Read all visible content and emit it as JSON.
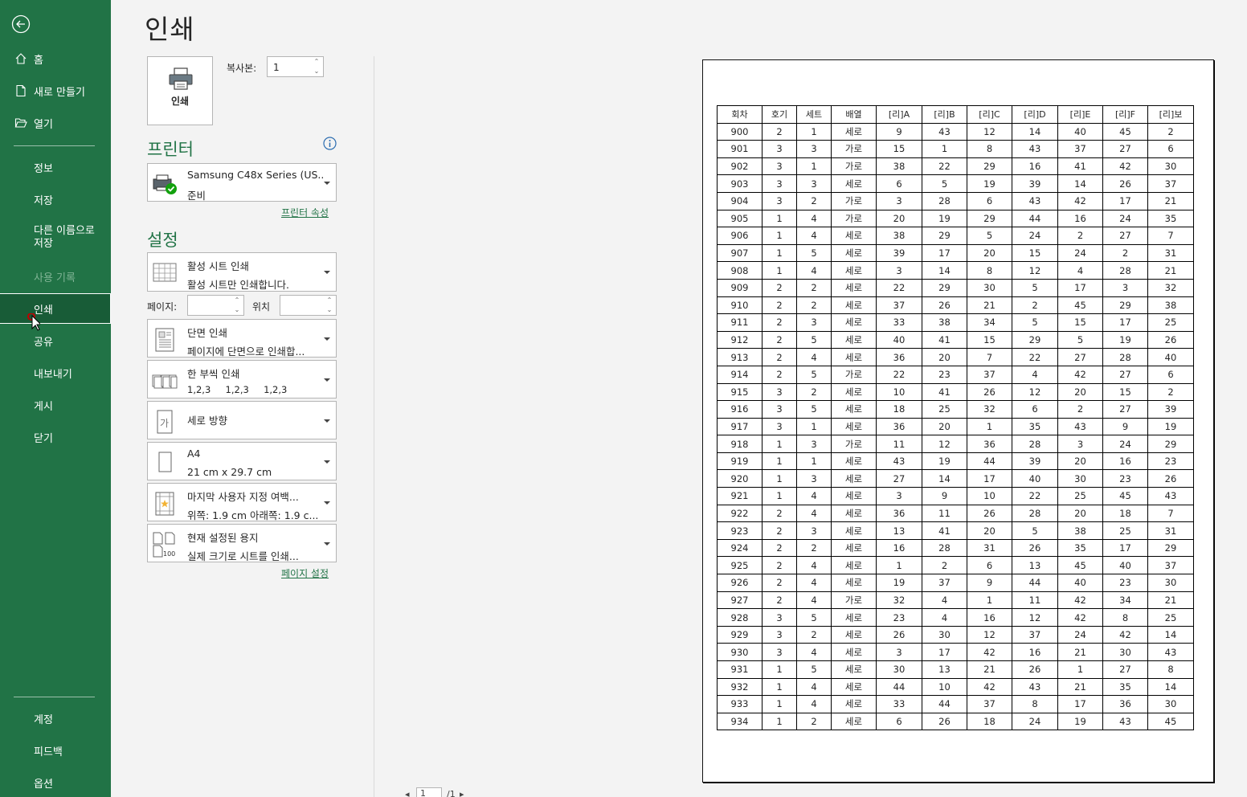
{
  "sidebar": {
    "home": "홈",
    "new": "새로 만들기",
    "open": "열기",
    "info": "정보",
    "save": "저장",
    "save_as": "다른 이름으로 저장",
    "history": "사용 기록",
    "print": "인쇄",
    "share": "공유",
    "export": "내보내기",
    "publish": "게시",
    "close": "닫기",
    "account": "계정",
    "feedback": "피드백",
    "options": "옵션",
    "accent_color": "#217346"
  },
  "page": {
    "title": "인쇄"
  },
  "print_button": {
    "label": "인쇄"
  },
  "copies": {
    "label": "복사본:",
    "value": "1"
  },
  "printer": {
    "section_title": "프린터",
    "name": "Samsung C48x Series (US...",
    "status": "준비",
    "properties_link": "프린터 속성"
  },
  "settings": {
    "section_title": "설정",
    "print_what": {
      "title": "활성 시트 인쇄",
      "desc": "활성 시트만 인쇄합니다."
    },
    "pages_label": "페이지:",
    "to_label": "위치",
    "sides": {
      "title": "단면 인쇄",
      "desc": "페이지에 단면으로 인쇄합..."
    },
    "collate": {
      "title": "한 부씩 인쇄",
      "desc": "1,2,3     1,2,3     1,2,3"
    },
    "orientation": {
      "title": "세로 방향"
    },
    "paper": {
      "title": "A4",
      "desc": "21 cm x 29.7 cm"
    },
    "margins": {
      "title": "마지막 사용자 지정 여백...",
      "desc": "위쪽: 1.9 cm 아래쪽: 1.9 c..."
    },
    "scaling": {
      "title": "현재 설정된 용지",
      "desc": "실제 크기로 시트를 인쇄..."
    },
    "page_setup_link": "페이지 설정"
  },
  "pager": {
    "current": "1",
    "total": "/1"
  },
  "sheet": {
    "headers": [
      "회차",
      "호기",
      "세트",
      "배열",
      "[리]A",
      "[리]B",
      "[리]C",
      "[리]D",
      "[리]E",
      "[리]F",
      "[리]보"
    ],
    "rows": [
      [
        "900",
        "2",
        "1",
        "세로",
        "9",
        "43",
        "12",
        "14",
        "40",
        "45",
        "2"
      ],
      [
        "901",
        "3",
        "3",
        "가로",
        "15",
        "1",
        "8",
        "43",
        "37",
        "27",
        "6"
      ],
      [
        "902",
        "3",
        "1",
        "가로",
        "38",
        "22",
        "29",
        "16",
        "41",
        "42",
        "30"
      ],
      [
        "903",
        "3",
        "3",
        "세로",
        "6",
        "5",
        "19",
        "39",
        "14",
        "26",
        "37"
      ],
      [
        "904",
        "3",
        "2",
        "가로",
        "3",
        "28",
        "6",
        "43",
        "42",
        "17",
        "21"
      ],
      [
        "905",
        "1",
        "4",
        "가로",
        "20",
        "19",
        "29",
        "44",
        "16",
        "24",
        "35"
      ],
      [
        "906",
        "1",
        "4",
        "세로",
        "38",
        "29",
        "5",
        "24",
        "2",
        "27",
        "7"
      ],
      [
        "907",
        "1",
        "5",
        "세로",
        "39",
        "17",
        "20",
        "15",
        "24",
        "2",
        "31"
      ],
      [
        "908",
        "1",
        "4",
        "세로",
        "3",
        "14",
        "8",
        "12",
        "4",
        "28",
        "21"
      ],
      [
        "909",
        "2",
        "2",
        "세로",
        "22",
        "29",
        "30",
        "5",
        "17",
        "3",
        "32"
      ],
      [
        "910",
        "2",
        "2",
        "세로",
        "37",
        "26",
        "21",
        "2",
        "45",
        "29",
        "38"
      ],
      [
        "911",
        "2",
        "3",
        "세로",
        "33",
        "38",
        "34",
        "5",
        "15",
        "17",
        "25"
      ],
      [
        "912",
        "2",
        "5",
        "세로",
        "40",
        "41",
        "15",
        "29",
        "5",
        "19",
        "26"
      ],
      [
        "913",
        "2",
        "4",
        "세로",
        "36",
        "20",
        "7",
        "22",
        "27",
        "28",
        "40"
      ],
      [
        "914",
        "2",
        "5",
        "가로",
        "22",
        "23",
        "37",
        "4",
        "42",
        "27",
        "6"
      ],
      [
        "915",
        "3",
        "2",
        "세로",
        "10",
        "41",
        "26",
        "12",
        "20",
        "15",
        "2"
      ],
      [
        "916",
        "3",
        "5",
        "세로",
        "18",
        "25",
        "32",
        "6",
        "2",
        "27",
        "39"
      ],
      [
        "917",
        "3",
        "1",
        "세로",
        "36",
        "20",
        "1",
        "35",
        "43",
        "9",
        "19"
      ],
      [
        "918",
        "1",
        "3",
        "가로",
        "11",
        "12",
        "36",
        "28",
        "3",
        "24",
        "29"
      ],
      [
        "919",
        "1",
        "1",
        "세로",
        "43",
        "19",
        "44",
        "39",
        "20",
        "16",
        "23"
      ],
      [
        "920",
        "1",
        "3",
        "세로",
        "27",
        "14",
        "17",
        "40",
        "30",
        "23",
        "26"
      ],
      [
        "921",
        "1",
        "4",
        "세로",
        "3",
        "9",
        "10",
        "22",
        "25",
        "45",
        "43"
      ],
      [
        "922",
        "2",
        "4",
        "세로",
        "36",
        "11",
        "26",
        "28",
        "20",
        "18",
        "7"
      ],
      [
        "923",
        "2",
        "3",
        "세로",
        "13",
        "41",
        "20",
        "5",
        "38",
        "25",
        "31"
      ],
      [
        "924",
        "2",
        "2",
        "세로",
        "16",
        "28",
        "31",
        "26",
        "35",
        "17",
        "29"
      ],
      [
        "925",
        "2",
        "4",
        "세로",
        "1",
        "2",
        "6",
        "13",
        "45",
        "40",
        "37"
      ],
      [
        "926",
        "2",
        "4",
        "세로",
        "19",
        "37",
        "9",
        "44",
        "40",
        "23",
        "30"
      ],
      [
        "927",
        "2",
        "4",
        "가로",
        "32",
        "4",
        "1",
        "11",
        "42",
        "34",
        "21"
      ],
      [
        "928",
        "3",
        "5",
        "세로",
        "23",
        "4",
        "16",
        "12",
        "42",
        "8",
        "25"
      ],
      [
        "929",
        "3",
        "2",
        "세로",
        "26",
        "30",
        "12",
        "37",
        "24",
        "42",
        "14"
      ],
      [
        "930",
        "3",
        "4",
        "세로",
        "3",
        "17",
        "42",
        "16",
        "21",
        "30",
        "43"
      ],
      [
        "931",
        "1",
        "5",
        "세로",
        "30",
        "13",
        "21",
        "26",
        "1",
        "27",
        "8"
      ],
      [
        "932",
        "1",
        "4",
        "세로",
        "44",
        "10",
        "42",
        "43",
        "21",
        "35",
        "14"
      ],
      [
        "933",
        "1",
        "4",
        "세로",
        "33",
        "44",
        "37",
        "8",
        "17",
        "36",
        "30"
      ],
      [
        "934",
        "1",
        "2",
        "세로",
        "6",
        "26",
        "18",
        "24",
        "19",
        "43",
        "45"
      ]
    ]
  }
}
